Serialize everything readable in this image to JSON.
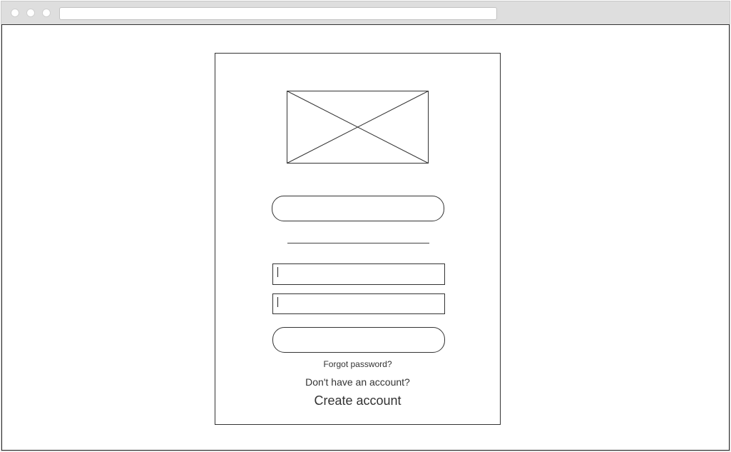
{
  "login": {
    "forgot_password": "Forgot password?",
    "no_account": "Don't have an account?",
    "create_account": "Create account"
  },
  "icons": {
    "logo": "image-placeholder-icon"
  }
}
